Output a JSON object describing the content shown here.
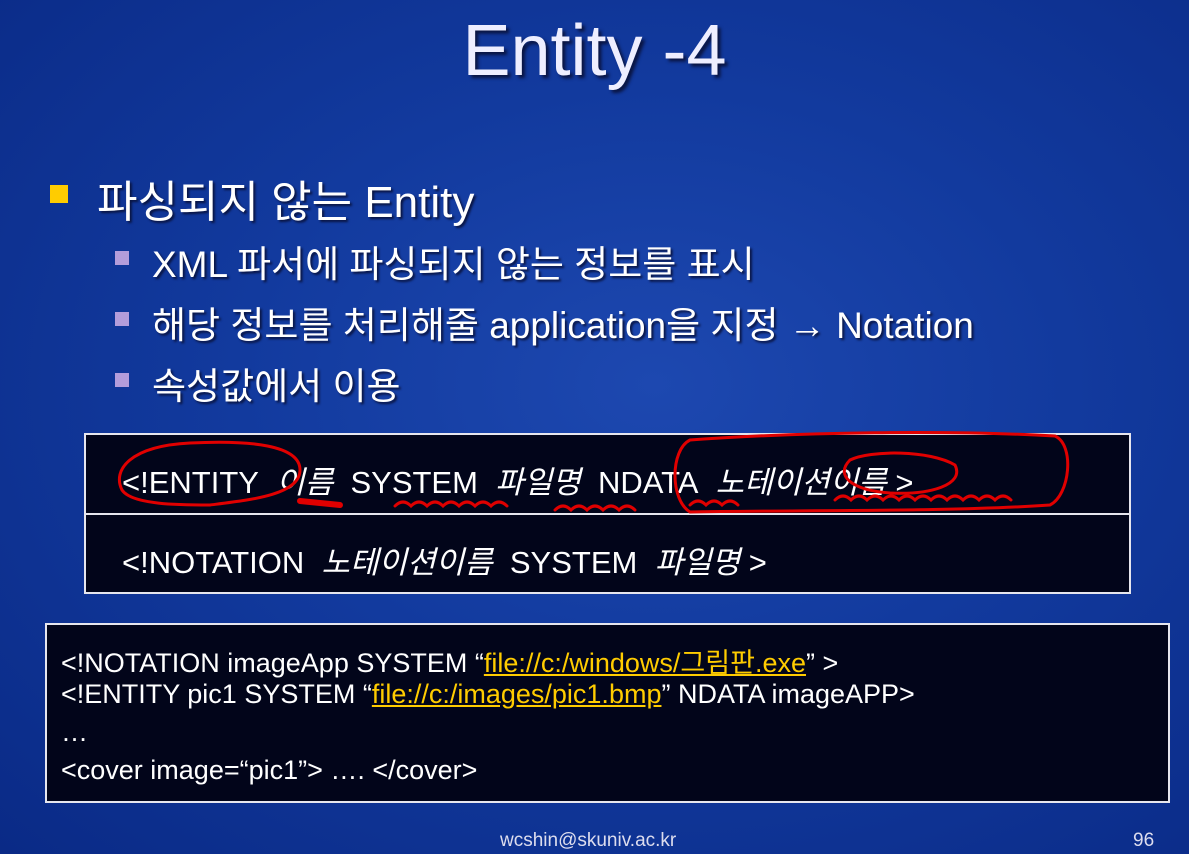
{
  "title": "Entity -4",
  "bullet": "파싱되지 않는 Entity",
  "sub_bullets": [
    "XML 파서에 파싱되지 않는 정보를 표시",
    "해당 정보를 처리해줄 application을 지정 → Notation",
    "속성값에서 이용"
  ],
  "syntax": {
    "entity": {
      "kw": "<!ENTITY",
      "name": "이름",
      "system": "SYSTEM",
      "file": "파일명",
      "ndata": "NDATA",
      "notation": "노테이션이름",
      "end": ">"
    },
    "notation": {
      "kw": "<!NOTATION",
      "name": "노테이션이름",
      "system": "SYSTEM",
      "file": "파일명",
      "end": ">"
    }
  },
  "example": {
    "line1_pre": "<!NOTATION  imageApp  SYSTEM  “",
    "line1_link": "file://c:/windows/그림판.exe",
    "line1_post": "” >",
    "line2_pre": "<!ENTITY  pic1  SYSTEM  “",
    "line2_link": "file://c:/images/pic1.bmp",
    "line2_post": "” NDATA imageAPP>",
    "line3": " …",
    "line4": "<cover image=“pic1”>  …. </cover>"
  },
  "footer": {
    "email": "wcshin@skuniv.ac.kr",
    "page": "96"
  },
  "colors": {
    "accent": "#ffcc00",
    "annotation": "#e00000"
  }
}
